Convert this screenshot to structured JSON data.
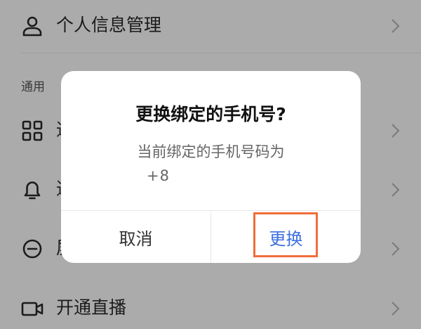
{
  "settings": {
    "profile_row": {
      "label": "个人信息管理",
      "icon": "person-icon"
    },
    "section_general": "通用",
    "rows": [
      {
        "label_fragment": "通",
        "icon": "grid-icon"
      },
      {
        "label_fragment": "通",
        "icon": "bell-icon"
      },
      {
        "label_fragment": "屏",
        "icon": "minus-circle-icon"
      },
      {
        "label": "开通直播",
        "icon": "video-camera-icon"
      }
    ]
  },
  "dialog": {
    "title": "更换绑定的手机号?",
    "message": "当前绑定的手机号码为",
    "phone_visible": "+8",
    "cancel_label": "取消",
    "confirm_label": "更换"
  },
  "colors": {
    "background_dimmed": "#ababab",
    "confirm_text": "#3d6fe0",
    "highlight_border": "#f16d3b"
  }
}
